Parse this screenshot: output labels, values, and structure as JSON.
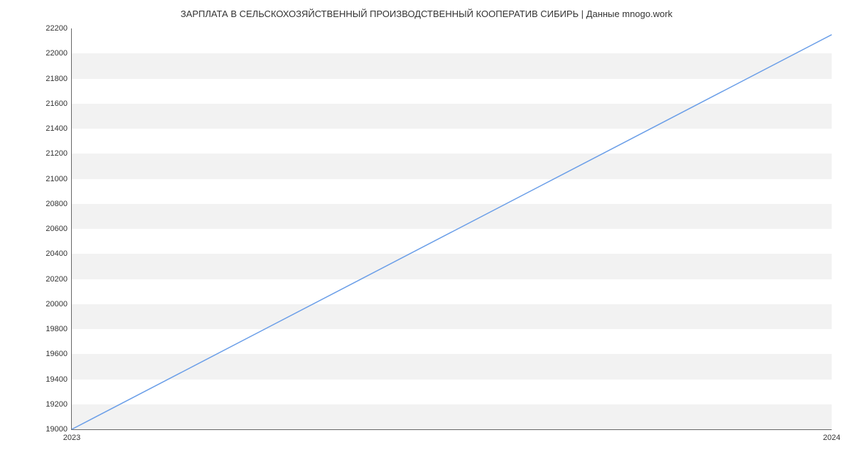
{
  "chart_data": {
    "type": "line",
    "title": "ЗАРПЛАТА В СЕЛЬСКОХОЗЯЙСТВЕННЫЙ ПРОИЗВОДСТВЕННЫЙ КООПЕРАТИВ СИБИРЬ | Данные mnogo.work",
    "x": [
      2023,
      2024
    ],
    "values": [
      19000,
      22150
    ],
    "xlabel": "",
    "ylabel": "",
    "ylim": [
      19000,
      22200
    ],
    "xlim": [
      2023,
      2024
    ],
    "y_ticks": [
      19000,
      19200,
      19400,
      19600,
      19800,
      20000,
      20200,
      20400,
      20600,
      20800,
      21000,
      21200,
      21400,
      21600,
      21800,
      22000,
      22200
    ],
    "x_ticks": [
      2023,
      2024
    ],
    "line_color": "#6a9ee8",
    "grid_band_color": "#f2f2f2"
  }
}
